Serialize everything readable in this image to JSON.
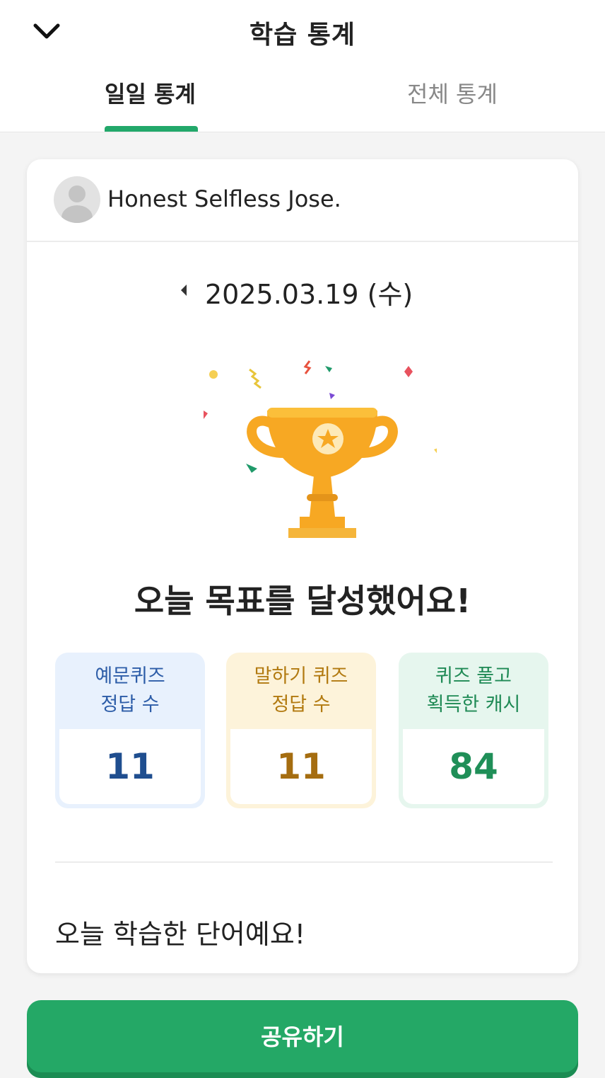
{
  "header": {
    "title": "학습 통계",
    "tabs": [
      {
        "label": "일일 통계",
        "active": true
      },
      {
        "label": "전체 통계",
        "active": false
      }
    ]
  },
  "profile": {
    "name": "Honest Selfless Jose."
  },
  "date": {
    "text": "2025.03.19 (수)"
  },
  "achievement": {
    "title": "오늘 목표를 달성했어요!"
  },
  "stats": [
    {
      "line1": "예문퀴즈",
      "line2": "정답 수",
      "value": "11"
    },
    {
      "line1": "말하기 퀴즈",
      "line2": "정답 수",
      "value": "11"
    },
    {
      "line1": "퀴즈 풀고",
      "line2": "획득한 캐시",
      "value": "84"
    }
  ],
  "words": {
    "title": "오늘 학습한 단어예요!"
  },
  "share": {
    "label": "공유하기"
  },
  "colors": {
    "accent": "#24a866",
    "trophy": "#f7a823"
  }
}
